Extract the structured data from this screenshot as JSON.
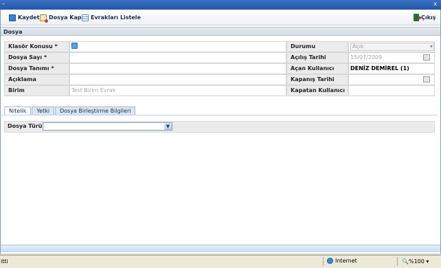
{
  "window": {
    "title": "–",
    "close": "x"
  },
  "toolbar": {
    "save_label": "Kaydet",
    "close_file_label": "Dosya Kapat",
    "list_docs_label": "Evrakları Listele",
    "exit_label": "Çıkış"
  },
  "section": {
    "title": "Dosya"
  },
  "form": {
    "klasor_konusu": "Klasör Konusu *",
    "dosya_sayi": "Dosya Sayı *",
    "dosya_tanimi": "Dosya Tanımı *",
    "aciklama": "Açıklama",
    "birim": "Birim",
    "birim_value": "Test Birim Evrak",
    "durumu": "Durumu",
    "durumu_value": "Açık",
    "acilis_tarihi": "Açılış Tarihi",
    "acilis_tarihi_value": "15/07/2009",
    "acan_kullanici": "Açan Kullanıcı",
    "acan_kullanici_value": "DENİZ DEMİREL (1)",
    "kapanis_tarihi": "Kapanış Tarihi",
    "kapatan_kullanici": "Kapatan Kullanıcı"
  },
  "tabs": [
    {
      "label": "Nitelik"
    },
    {
      "label": "Yetki"
    },
    {
      "label": "Dosya Birleştirme Bilgileri"
    }
  ],
  "panel": {
    "dosya_turu_label": "Dosya Türü",
    "dosya_turu_value": ""
  },
  "status": {
    "left": "itti",
    "zone": "Internet",
    "zoom": "%100"
  },
  "colors": {
    "accent": "#3a72c4",
    "label_bg": "#ebebeb"
  }
}
